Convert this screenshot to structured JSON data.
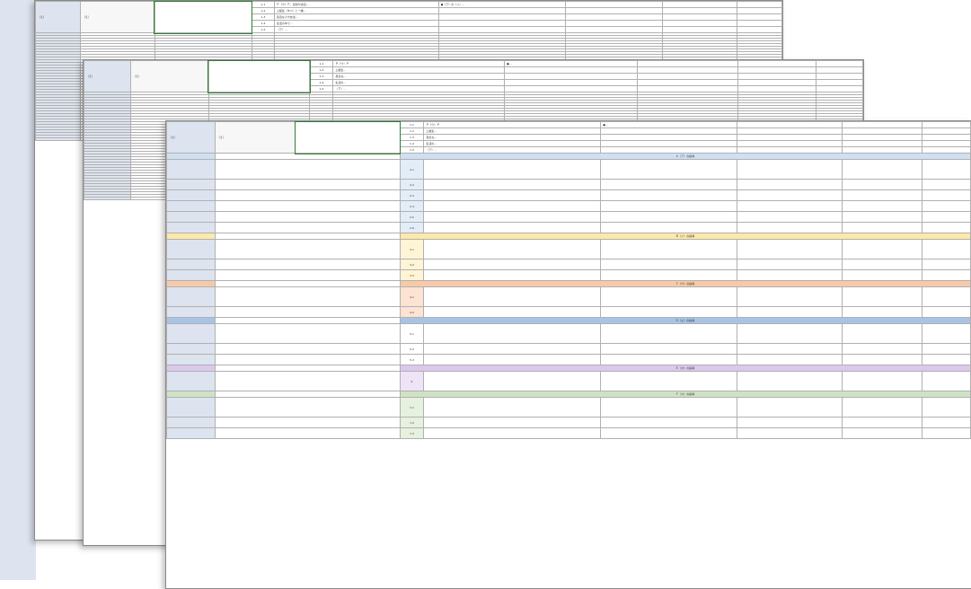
{
  "pages": [
    {
      "name": "page-1",
      "top_rows": [
        {
          "label": "（え）",
          "code": "1-1",
          "item": "Ｐ（ウ）Ｐ、自然や身近...",
          "note": "●（ア）の（イ）..."
        },
        {
          "label": "",
          "code": "1-2",
          "item": "上級生（すべ）と一緒...",
          "note": ""
        },
        {
          "label": "",
          "code": "1-3",
          "item": "身近な人や友達...",
          "note": ""
        },
        {
          "label": "",
          "code": "1-4",
          "item": "生活の中で...",
          "note": ""
        },
        {
          "label": "",
          "code": "1-5",
          "item": "（ア）...",
          "note": ""
        }
      ],
      "side_labels": [
        "（え）",
        "（お）",
        "（か）"
      ]
    },
    {
      "name": "page-2",
      "top_rows": [
        {
          "label": "（え）",
          "code": "1-1",
          "item": "Ｐ（ウ）Ｐ",
          "note": "●..."
        },
        {
          "label": "",
          "code": "1-2",
          "item": "上級生...",
          "note": ""
        },
        {
          "label": "",
          "code": "1-3",
          "item": "身近な...",
          "note": ""
        },
        {
          "label": "",
          "code": "1-4",
          "item": "生活の...",
          "note": ""
        },
        {
          "label": "",
          "code": "1-5",
          "item": "（ア）...",
          "note": ""
        }
      ],
      "side_labels": [
        "（え）",
        "（お）",
        "（か）",
        "（き）"
      ]
    },
    {
      "name": "page-3",
      "top_rows": [
        {
          "label": "（え）",
          "code": "1-1",
          "item": "Ｐ（ウ）Ｐ",
          "note": "●..."
        },
        {
          "label": "",
          "code": "1-2",
          "item": "上級生...",
          "note": ""
        },
        {
          "label": "",
          "code": "1-3",
          "item": "身近な...",
          "note": ""
        },
        {
          "label": "",
          "code": "1-4",
          "item": "生活の...",
          "note": ""
        },
        {
          "label": "",
          "code": "1-5",
          "item": "（ア）...",
          "note": ""
        }
      ],
      "sections": [
        {
          "color": "blue",
          "title": "Ａ（ア）の指導",
          "rows": [
            "2-1",
            "2-2",
            "2-3",
            "2-4",
            "2-5",
            "2-6"
          ]
        },
        {
          "color": "yellow",
          "title": "Ｂ（イ）の指導",
          "rows": [
            "3-1",
            "3-2",
            "3-3"
          ]
        },
        {
          "color": "orange",
          "title": "Ｃ（ウ）の指導",
          "rows": [
            "4-1",
            "4-2"
          ]
        },
        {
          "color": "blue2",
          "title": "Ｄ（エ）の指導",
          "rows": [
            "5-1",
            "5-2",
            "5-3"
          ]
        },
        {
          "color": "purple",
          "title": "Ｅ（オ）の指導",
          "rows": [
            "6"
          ]
        },
        {
          "color": "green",
          "title": "Ｆ（カ）の指導",
          "rows": [
            "7-1",
            "7-2",
            "7-3"
          ]
        }
      ],
      "side_labels": [
        "（え）",
        "（お）",
        "（か）",
        "（き）",
        "（く）"
      ]
    }
  ]
}
